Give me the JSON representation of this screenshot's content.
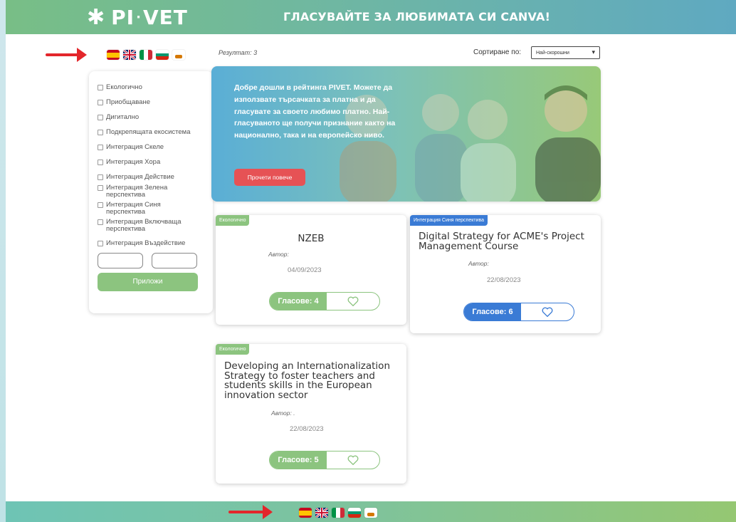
{
  "header": {
    "logo_text": "PI",
    "logo_text2": "VET",
    "title": "ГЛАСУВАЙТЕ ЗА ЛЮБИМАТА СИ CANVA!"
  },
  "languages": [
    "es",
    "gb",
    "it",
    "bg",
    "cy"
  ],
  "sidebar": {
    "filters": [
      "Екологично",
      "Приобщаване",
      "Дигитално",
      "Подкрепящата екосистема",
      "Интеграция Скеле",
      "Интеграция Хора",
      "Интеграция Действие",
      "Интеграция Зелена перспектива",
      "Интеграция Синя перспектива",
      "Интеграция Включваща перспектива",
      "Интеграция Въздействие"
    ],
    "apply_label": "Приложи"
  },
  "results": {
    "label": "Резултат: 3",
    "sort_label": "Сортиране по:",
    "sort_value": "Най-скорошни"
  },
  "hero": {
    "text": "Добре дошли в рейтинга PIVET. Можете да използвате търсачката за платна и да гласувате за своето любимо платно. Най-гласуваното ще получи признание както на национално, така и на европейско ниво.",
    "button": "Прочети повече"
  },
  "cards": [
    {
      "badge": "Екологично",
      "title": "NZEB",
      "author": "Автор:",
      "date": "04/09/2023",
      "votes": "Гласове: 4"
    },
    {
      "badge": "Интеграция Синя перспектива",
      "title": "Digital Strategy for ACME's Project Management Course",
      "author": "Автор:",
      "date": "22/08/2023",
      "votes": "Гласове: 6"
    },
    {
      "badge": "Екологично",
      "title": "Developing an Internationalization Strategy to foster teachers and students skills in the European innovation sector",
      "author": "Автор: .",
      "date": "22/08/2023",
      "votes": "Гласове: 5"
    }
  ],
  "colors": {
    "green": "#8cc47f",
    "blue": "#3a7bd5",
    "red": "#e65255"
  }
}
